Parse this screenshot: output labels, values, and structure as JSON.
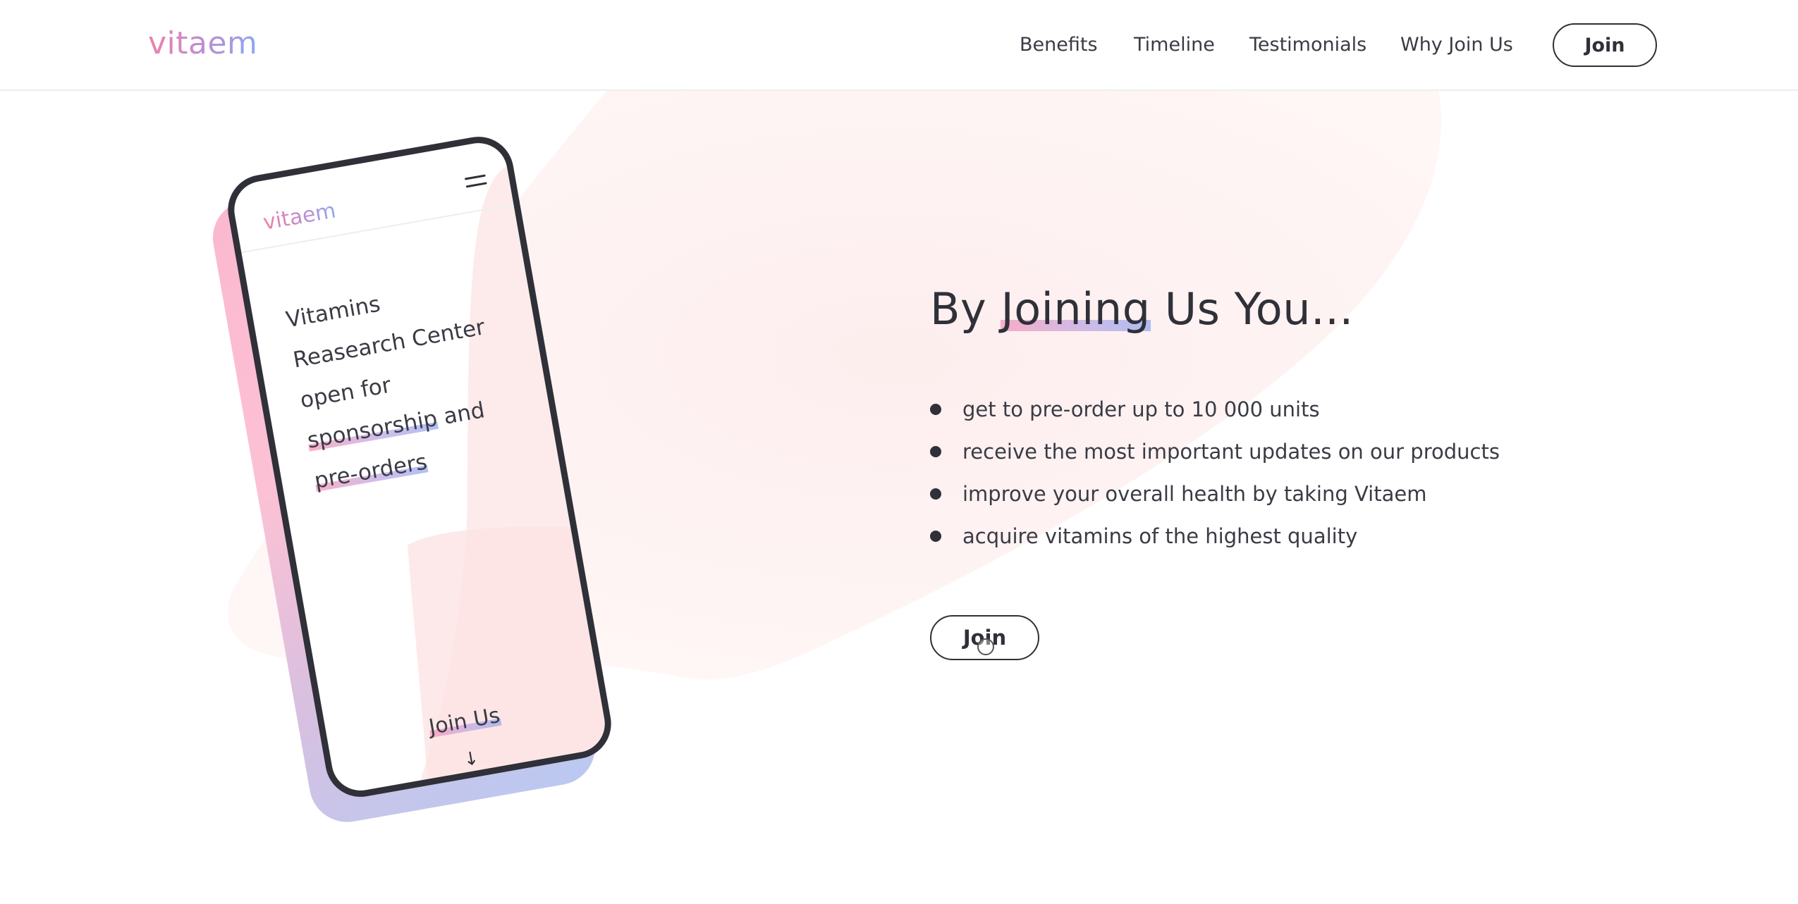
{
  "colors": {
    "text": "#2f3038",
    "brand_gradient": [
      "#ef7fab",
      "#b98fd6",
      "#8ea8ee"
    ],
    "blob": "#fdeeee",
    "phone_frame": "#2f3038"
  },
  "header": {
    "logo": "vitaem",
    "nav": [
      {
        "label": "Benefits"
      },
      {
        "label": "Timeline"
      },
      {
        "label": "Testimonials"
      },
      {
        "label": "Why Join Us"
      }
    ],
    "join_label": "Join"
  },
  "phone": {
    "logo": "vitaem",
    "menu_icon": "hamburger-menu-icon",
    "headline": {
      "part1": "Vitamins Reasearch Center open for ",
      "highlight1": "sponsorship",
      "part2": " and ",
      "highlight2": "pre-orders"
    },
    "join_label": "Join Us",
    "arrow": "↓"
  },
  "main": {
    "heading": {
      "before": "By ",
      "highlight": "Joining",
      "after": " Us You..."
    },
    "benefits": [
      "get to pre-order up to 10 000 units",
      "receive the most important updates on our products",
      "improve your overall health by taking Vitaem",
      "acquire vitamins of the highest quality"
    ],
    "join_label": "Join"
  }
}
